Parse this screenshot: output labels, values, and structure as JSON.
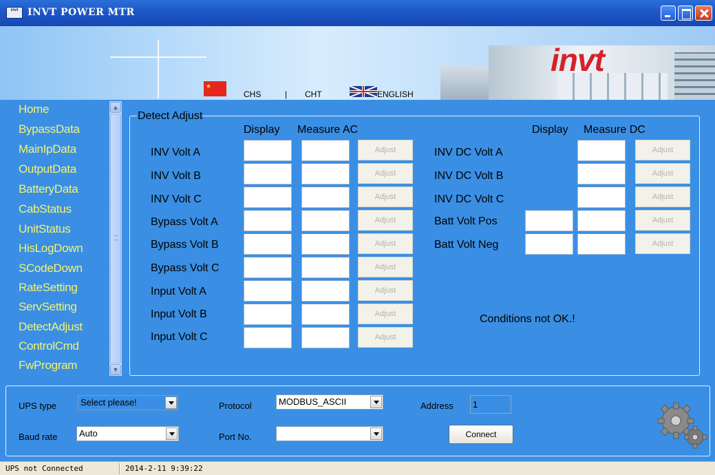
{
  "window": {
    "title": "INVT POWER MTR",
    "icon_text": "invt"
  },
  "banner": {
    "logo": "invt",
    "lang_chs": "CHS",
    "lang_sep": "|",
    "lang_cht": "CHT",
    "lang_en": "ENGLISH"
  },
  "sidebar": {
    "items": [
      "Home",
      "BypassData",
      "MainIpData",
      "OutputData",
      "BatteryData",
      "CabStatus",
      "UnitStatus",
      "HisLogDown",
      "SCodeDown",
      "RateSetting",
      "ServSetting",
      "DetectAdjust",
      "ControlCmd",
      "FwProgram"
    ],
    "scroll_up": "▲",
    "scroll_down": "▼"
  },
  "detect": {
    "group_title": "Detect Adjust",
    "ac_header_display": "Display",
    "ac_header_measure": "Measure AC",
    "dc_header_display": "Display",
    "dc_header_measure": "Measure DC",
    "ac_rows": [
      "INV Volt A",
      "INV Volt B",
      "INV Volt C",
      "Bypass Volt A",
      "Bypass Volt B",
      "Bypass Volt C",
      "Input Volt A",
      "Input Volt B",
      "Input Volt C"
    ],
    "dc_rows": [
      "INV DC Volt A",
      "INV DC Volt B",
      "INV DC Volt C",
      "Batt Volt Pos",
      "Batt Volt Neg"
    ],
    "adjust_label": "Adjust",
    "status": "Conditions not OK.!"
  },
  "connection": {
    "ups_type_label": "UPS type",
    "ups_type_value": "Select please!",
    "protocol_label": "Protocol",
    "protocol_value": "MODBUS_ASCII",
    "address_label": "Address",
    "address_value": "1",
    "baud_label": "Baud rate",
    "baud_value": "Auto",
    "port_label": "Port No.",
    "port_value": "",
    "connect_label": "Connect"
  },
  "statusbar": {
    "connection": "UPS not Connected",
    "datetime": "2014-2-11 9:39:22"
  },
  "colors": {
    "background": "#3a8fe4",
    "nav_text": "#f4f272",
    "titlebar": "#1d57c7",
    "logo_red": "#d4222a"
  }
}
